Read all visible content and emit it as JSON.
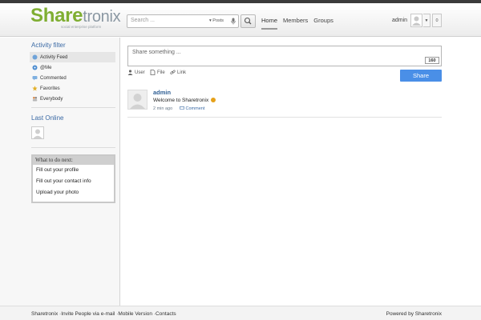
{
  "header": {
    "logo": {
      "brand_prefix": "Share",
      "brand_suffix": "tronix",
      "tagline": "social enterprise platform"
    },
    "search": {
      "placeholder": "Search ...",
      "scope": "Posts"
    },
    "nav": [
      {
        "label": "Home",
        "active": true
      },
      {
        "label": "Members"
      },
      {
        "label": "Groups"
      }
    ],
    "user": {
      "name": "admin",
      "notifications": "0"
    }
  },
  "sidebar": {
    "activity_title": "Activity filter",
    "filters": [
      {
        "label": "Activity Feed",
        "icon": "feed-icon",
        "active": true
      },
      {
        "label": "@Me",
        "icon": "at-icon"
      },
      {
        "label": "Commented",
        "icon": "comment-icon"
      },
      {
        "label": "Favorites",
        "icon": "star-icon"
      },
      {
        "label": "Everybody",
        "icon": "people-icon"
      }
    ],
    "last_online_title": "Last Online",
    "todo": {
      "title": "What to do next:",
      "items": [
        "Fill out your profile",
        "Fill out your contact info",
        "Upload your photo"
      ]
    }
  },
  "composer": {
    "placeholder": "Share something ...",
    "counter": "160",
    "attachments": [
      "User",
      "File",
      "Link"
    ],
    "share_label": "Share"
  },
  "feed": [
    {
      "author": "admin",
      "text": "Welcome to Sharetronix",
      "time": "2 min ago",
      "action": "Comment"
    }
  ],
  "footer": {
    "left": "Sharetronix ·Invite People via e-mail ·Mobile Version ·Contacts",
    "right": "Powered by Sharetronix"
  },
  "colors": {
    "accent": "#4a8fe7",
    "link": "#3b6aa5",
    "brand_green": "#7fae32"
  }
}
